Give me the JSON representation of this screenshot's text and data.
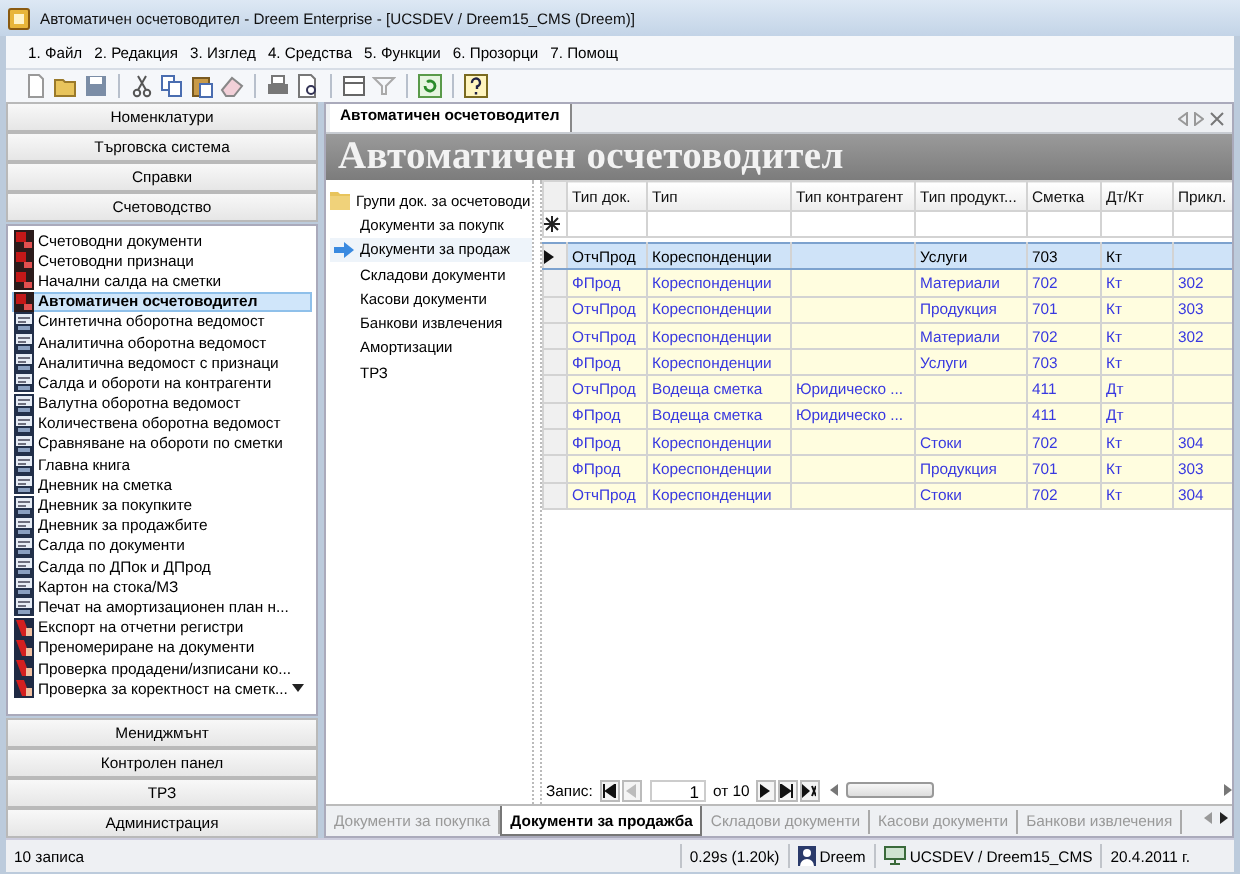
{
  "window": {
    "title": "Автоматичен осчетоводител - Dreem Enterprise - [UCSDEV / Dreem15_CMS (Dreem)]"
  },
  "menu": [
    "1. Файл",
    "2. Редакция",
    "3. Изглед",
    "4. Средства",
    "5. Функции",
    "6. Прозорци",
    "7. Помощ"
  ],
  "nav_panel": {
    "sections_top": [
      "Номенклатури",
      "Търговска система",
      "Справки",
      "Счетоводство"
    ],
    "items": [
      {
        "label": "Счетоводни документи",
        "kind": "ledger",
        "selected": false
      },
      {
        "label": "Счетоводни признаци",
        "kind": "ledger",
        "selected": false
      },
      {
        "label": "Начални салда на сметки",
        "kind": "ledger",
        "selected": false
      },
      {
        "label": "Автоматичен осчетоводител",
        "kind": "ledger",
        "selected": true
      },
      {
        "label": "Синтетична оборотна ведомост",
        "kind": "report",
        "selected": false
      },
      {
        "label": "Аналитична оборотна ведомост",
        "kind": "report",
        "selected": false
      },
      {
        "label": "Аналитична ведомост с признаци",
        "kind": "report",
        "selected": false
      },
      {
        "label": "Салда и обороти на контрагенти",
        "kind": "report",
        "selected": false
      },
      {
        "label": "Валутна оборотна ведомост",
        "kind": "report",
        "selected": false
      },
      {
        "label": "Количествена оборотна ведомост",
        "kind": "report",
        "selected": false
      },
      {
        "label": "Сравняване на обороти по сметки",
        "kind": "report",
        "selected": false
      },
      {
        "label": "Главна книга",
        "kind": "report",
        "selected": false
      },
      {
        "label": "Дневник на сметка",
        "kind": "report",
        "selected": false
      },
      {
        "label": "Дневник за покупките",
        "kind": "report",
        "selected": false
      },
      {
        "label": "Дневник за продажбите",
        "kind": "report",
        "selected": false
      },
      {
        "label": "Салда по документи",
        "kind": "report",
        "selected": false
      },
      {
        "label": "Салда по ДПок и ДПрод",
        "kind": "report",
        "selected": false
      },
      {
        "label": "Картон на стока/МЗ",
        "kind": "report",
        "selected": false
      },
      {
        "label": "Печат на амортизационен план н...",
        "kind": "report",
        "selected": false
      },
      {
        "label": "Експорт на отчетни регистри",
        "kind": "tool",
        "selected": false
      },
      {
        "label": "Преномериране на документи",
        "kind": "tool",
        "selected": false
      },
      {
        "label": "Проверка продадени/изписани ко...",
        "kind": "tool",
        "selected": false
      },
      {
        "label": "Проверка за коректност на сметк...",
        "kind": "tool",
        "selected": false
      }
    ],
    "sections_bottom": [
      "Мениджмънт",
      "Контролен панел",
      "ТРЗ",
      "Администрация"
    ]
  },
  "document": {
    "tab": "Автоматичен осчетоводител",
    "heading": "Автоматичен осчетоводител",
    "tree": {
      "label": "Групи док. за осчетоводи",
      "children": [
        {
          "label": "Документи за покупк",
          "selected": false
        },
        {
          "label": "Документи за продаж",
          "selected": true
        },
        {
          "label": "Складови документи",
          "selected": false
        },
        {
          "label": "Касови документи",
          "selected": false
        },
        {
          "label": "Банкови извлечения",
          "selected": false
        },
        {
          "label": "Амортизации",
          "selected": false
        },
        {
          "label": "ТРЗ",
          "selected": false
        }
      ]
    },
    "grid": {
      "columns": [
        "Тип док.",
        "Тип",
        "Тип контрагент",
        "Тип продукт...",
        "Сметка",
        "Дт/Кт",
        "Прикл."
      ],
      "rows": [
        {
          "cells": [
            "ОтчПрод",
            "Кореспонденции",
            null,
            "Услуги",
            "703",
            "Кт",
            null
          ],
          "selected": true
        },
        {
          "cells": [
            "ФПрод",
            "Кореспонденции",
            null,
            "Материали",
            "702",
            "Кт",
            "302"
          ],
          "selected": false
        },
        {
          "cells": [
            "ОтчПрод",
            "Кореспонденции",
            null,
            "Продукция",
            "701",
            "Кт",
            "303"
          ],
          "selected": false
        },
        {
          "cells": [
            "ОтчПрод",
            "Кореспонденции",
            null,
            "Материали",
            "702",
            "Кт",
            "302"
          ],
          "selected": false
        },
        {
          "cells": [
            "ФПрод",
            "Кореспонденции",
            null,
            "Услуги",
            "703",
            "Кт",
            null
          ],
          "selected": false
        },
        {
          "cells": [
            "ОтчПрод",
            "Водеща сметка",
            "Юридическо ...",
            null,
            "411",
            "Дт",
            null
          ],
          "selected": false
        },
        {
          "cells": [
            "ФПрод",
            "Водеща сметка",
            "Юридическо ...",
            null,
            "411",
            "Дт",
            null
          ],
          "selected": false
        },
        {
          "cells": [
            "ФПрод",
            "Кореспонденции",
            null,
            "Стоки",
            "702",
            "Кт",
            "304"
          ],
          "selected": false
        },
        {
          "cells": [
            "ФПрод",
            "Кореспонденции",
            null,
            "Продукция",
            "701",
            "Кт",
            "303"
          ],
          "selected": false
        },
        {
          "cells": [
            "ОтчПрод",
            "Кореспонденции",
            null,
            "Стоки",
            "702",
            "Кт",
            "304"
          ],
          "selected": false
        }
      ]
    },
    "navigator": {
      "label": "Запис:",
      "record": "1",
      "total": "от 10"
    },
    "tabs": [
      {
        "label": "Документи за покупка",
        "selected": false
      },
      {
        "label": "Документи за продажба",
        "selected": true
      },
      {
        "label": "Складови документи",
        "selected": false
      },
      {
        "label": "Касови документи",
        "selected": false
      },
      {
        "label": "Банкови извлечения",
        "selected": false
      }
    ]
  },
  "status_bar": {
    "records": "10 записа",
    "timing": "0.29s (1.20k)",
    "user": "Dreem",
    "connection": "UCSDEV / Dreem15_CMS",
    "date": "20.4.2011 г."
  }
}
